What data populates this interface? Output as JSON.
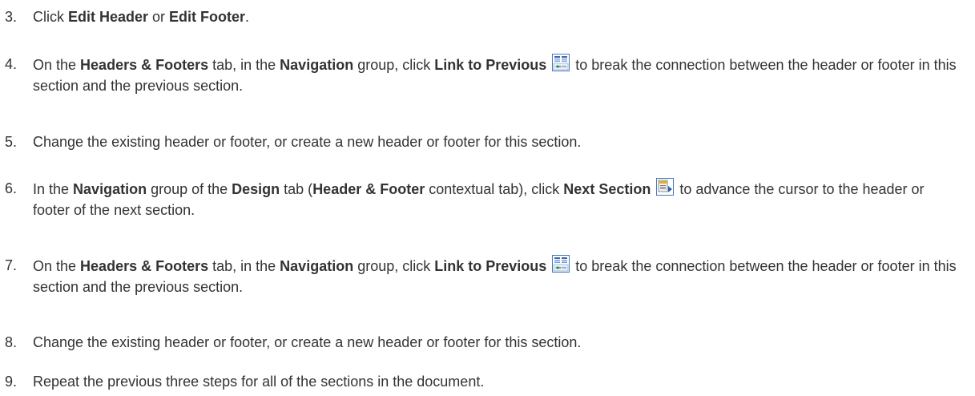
{
  "steps": [
    {
      "number": "3.",
      "parts": [
        {
          "t": "Click "
        },
        {
          "t": "Edit Header",
          "b": true
        },
        {
          "t": " or "
        },
        {
          "t": "Edit Footer",
          "b": true
        },
        {
          "t": "."
        }
      ]
    },
    {
      "number": "4.",
      "parts": [
        {
          "t": "On the "
        },
        {
          "t": "Headers & Footers",
          "b": true
        },
        {
          "t": " tab, in the "
        },
        {
          "t": "Navigation",
          "b": true
        },
        {
          "t": " group, click "
        },
        {
          "t": "Link to Previous",
          "b": true
        },
        {
          "t": " "
        },
        {
          "icon": "link-to-previous-icon"
        },
        {
          "t": " to break the connection between the header or footer in this section and the previous section."
        }
      ]
    },
    {
      "number": "5.",
      "parts": [
        {
          "t": "Change the existing header or footer, or create a new header or footer for this section."
        }
      ]
    },
    {
      "number": "6.",
      "parts": [
        {
          "t": "In the "
        },
        {
          "t": "Navigation",
          "b": true
        },
        {
          "t": " group of the "
        },
        {
          "t": "Design",
          "b": true
        },
        {
          "t": " tab ("
        },
        {
          "t": "Header & Footer",
          "b": true
        },
        {
          "t": " contextual tab), click "
        },
        {
          "t": "Next Section",
          "b": true
        },
        {
          "t": " "
        },
        {
          "icon": "next-section-icon"
        },
        {
          "t": " to advance the cursor to the header or footer of the next section."
        }
      ]
    },
    {
      "number": "7.",
      "parts": [
        {
          "t": "On the "
        },
        {
          "t": "Headers & Footers",
          "b": true
        },
        {
          "t": " tab, in the "
        },
        {
          "t": "Navigation",
          "b": true
        },
        {
          "t": " group, click "
        },
        {
          "t": "Link to Previous",
          "b": true
        },
        {
          "t": " "
        },
        {
          "icon": "link-to-previous-icon"
        },
        {
          "t": " to break the connection between the header or footer in this section and the previous section."
        }
      ]
    },
    {
      "number": "8.",
      "parts": [
        {
          "t": "Change the existing header or footer, or create a new header or footer for this section."
        }
      ]
    },
    {
      "number": "9.",
      "parts": [
        {
          "t": "Repeat the previous three steps for all of the sections in the document."
        }
      ]
    }
  ]
}
